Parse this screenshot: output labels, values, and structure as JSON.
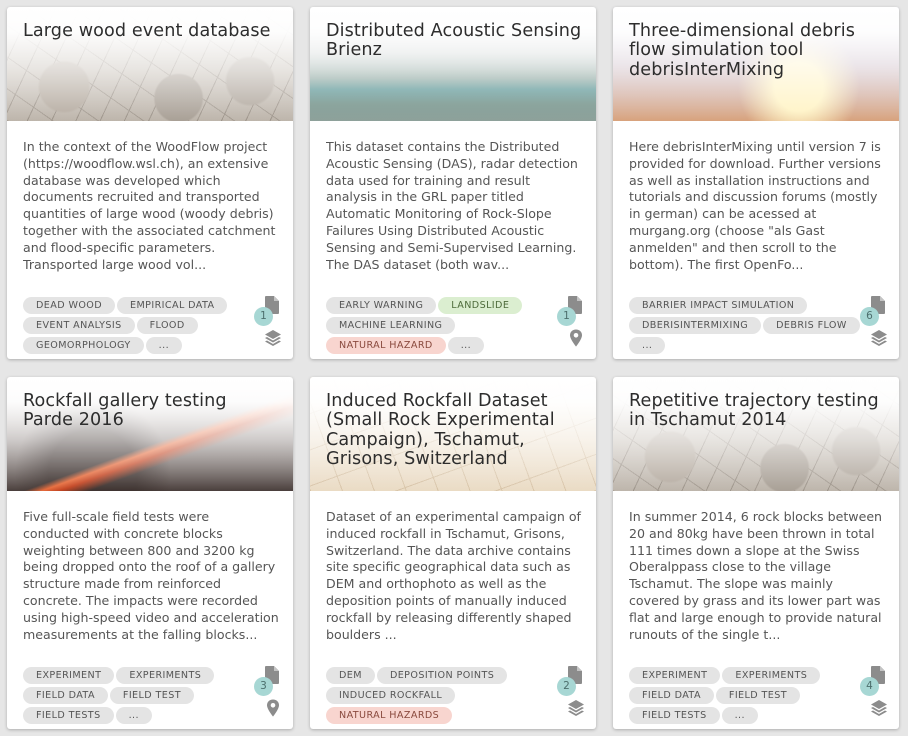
{
  "colors": {
    "page_background": "#e6e6e6",
    "card_background": "#ffffff",
    "tag_default": "#e4e4e4",
    "tag_green": "#dbeed0",
    "tag_red": "#f8d5cf",
    "count_badge": "#a7d7d4"
  },
  "cards": [
    {
      "title": "Large wood event database",
      "header_image": "cracked-earth",
      "description": "In the context of the WoodFlow project (https://woodflow.wsl.ch), an extensive database was developed which documents recruited and transported quantities of large wood (woody debris) together with the associated catchment and flood-specific parameters. Transported large wood vol...",
      "tags": [
        {
          "label": "DEAD WOOD",
          "style": "default"
        },
        {
          "label": "EMPIRICAL DATA",
          "style": "default"
        },
        {
          "label": "EVENT ANALYSIS",
          "style": "default"
        },
        {
          "label": "FLOOD",
          "style": "default"
        },
        {
          "label": "GEOMORPHOLOGY",
          "style": "default"
        },
        {
          "label": "...",
          "style": "default"
        }
      ],
      "resource_count": "1",
      "resource_icon": "document-icon",
      "type_icon": "layers-icon"
    },
    {
      "title": "Distributed Acoustic Sensing Brienz",
      "header_image": "mountain-lake",
      "description": "This dataset contains the Distributed Acoustic Sensing (DAS), radar detection data used for training and result analysis in the GRL paper titled Automatic Monitoring of Rock-Slope Failures Using Distributed Acoustic Sensing and Semi-Supervised Learning. The DAS dataset (both wav...",
      "tags": [
        {
          "label": "EARLY WARNING",
          "style": "default"
        },
        {
          "label": "LANDSLIDE",
          "style": "green"
        },
        {
          "label": "MACHINE LEARNING",
          "style": "default"
        },
        {
          "label": "NATURAL HAZARD",
          "style": "red"
        },
        {
          "label": "...",
          "style": "default"
        }
      ],
      "resource_count": "1",
      "resource_icon": "document-icon",
      "type_icon": "location-pin-icon"
    },
    {
      "title": "Three-dimensional debris flow simulation tool debrisInterMixing",
      "header_image": "lightning-sky",
      "description": "Here debrisInterMixing until version 7 is provided for download. Further versions as well as installation instructions and tutorials and discussion forums (mostly in german) can be acessed at murgang.org (choose \"als Gast anmelden\" and then scroll to the bottom). The first OpenFo...",
      "tags": [
        {
          "label": "BARRIER IMPACT SIMULATION",
          "style": "default"
        },
        {
          "label": "DBERISINTERMIXING",
          "style": "default"
        },
        {
          "label": "DEBRIS FLOW",
          "style": "default"
        },
        {
          "label": "...",
          "style": "default"
        }
      ],
      "resource_count": "6",
      "resource_icon": "document-icon",
      "type_icon": "layers-icon"
    },
    {
      "title": "Rockfall gallery testing Parde 2016",
      "header_image": "lava-flow",
      "description": "Five full-scale field tests were conducted with concrete blocks weighting between 800 and 3200 kg being dropped onto the roof of a gallery structure made from reinforced concrete. The impacts were recorded using high-speed video and acceleration measurements at the falling blocks...",
      "tags": [
        {
          "label": "EXPERIMENT",
          "style": "default"
        },
        {
          "label": "EXPERIMENTS",
          "style": "default"
        },
        {
          "label": "FIELD DATA",
          "style": "default"
        },
        {
          "label": "FIELD TEST",
          "style": "default"
        },
        {
          "label": "FIELD TESTS",
          "style": "default"
        },
        {
          "label": "...",
          "style": "default"
        }
      ],
      "resource_count": "3",
      "resource_icon": "document-icon",
      "type_icon": "location-pin-icon"
    },
    {
      "title": "Induced Rockfall Dataset (Small Rock Experimental Campaign), Tschamut, Grisons, Switzerland",
      "header_image": "dry-soil",
      "description": "Dataset of an experimental campaign of induced rockfall in Tschamut, Grisons, Switzerland. The data archive contains site specific geographical data such as DEM and orthophoto as well as the deposition points of manually induced rockfall by releasing differently shaped boulders ...",
      "tags": [
        {
          "label": "DEM",
          "style": "default"
        },
        {
          "label": "DEPOSITION POINTS",
          "style": "default"
        },
        {
          "label": "INDUCED ROCKFALL",
          "style": "default"
        },
        {
          "label": "NATURAL HAZARDS",
          "style": "red"
        }
      ],
      "resource_count": "2",
      "resource_icon": "document-icon",
      "type_icon": "layers-icon"
    },
    {
      "title": "Repetitive trajectory testing in Tschamut 2014",
      "header_image": "cracked-earth",
      "description": "In summer 2014, 6 rock blocks between 20 and 80kg have been thrown in total 111 times down a slope at the Swiss Oberalppass close to the village Tschamut. The slope was mainly covered by grass and its lower part was flat and large enough to provide natural runouts of the single t...",
      "tags": [
        {
          "label": "EXPERIMENT",
          "style": "default"
        },
        {
          "label": "EXPERIMENTS",
          "style": "default"
        },
        {
          "label": "FIELD DATA",
          "style": "default"
        },
        {
          "label": "FIELD TEST",
          "style": "default"
        },
        {
          "label": "FIELD TESTS",
          "style": "default"
        },
        {
          "label": "...",
          "style": "default"
        }
      ],
      "resource_count": "4",
      "resource_icon": "document-icon",
      "type_icon": "layers-icon"
    }
  ]
}
